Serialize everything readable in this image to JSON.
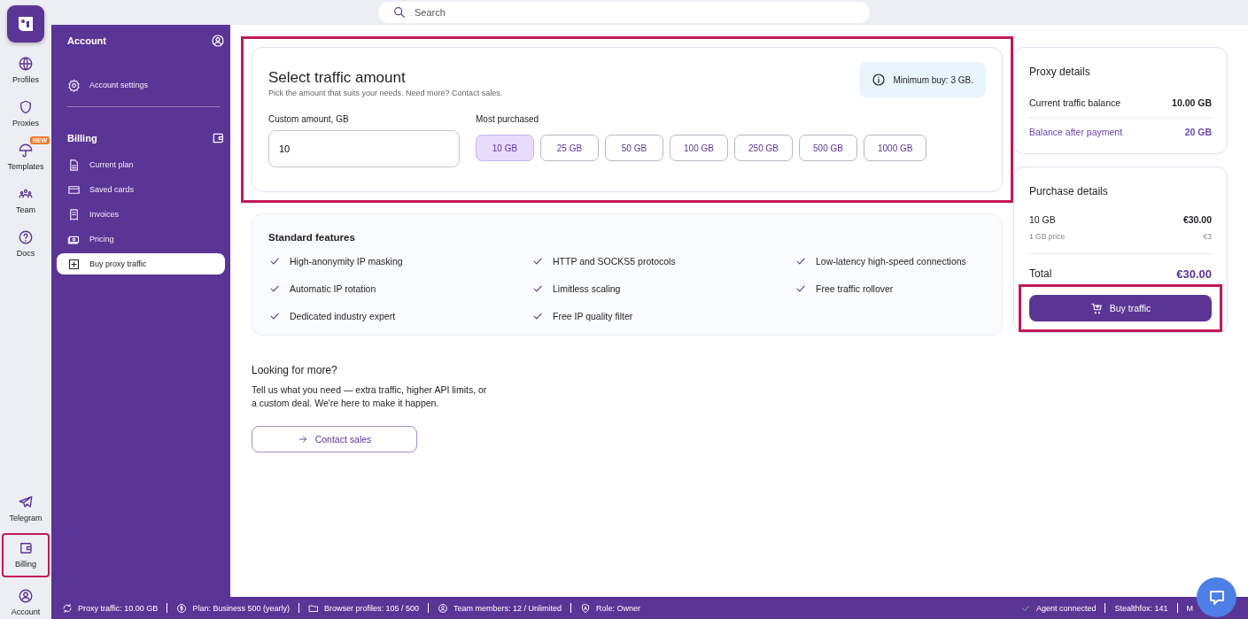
{
  "search": {
    "placeholder": "Search"
  },
  "rail": {
    "top": [
      {
        "label": "Profiles",
        "highlighted": false
      },
      {
        "label": "Proxies",
        "highlighted": false
      },
      {
        "label": "Templates",
        "highlighted": false,
        "badge": "NEW"
      },
      {
        "label": "Team",
        "highlighted": false
      },
      {
        "label": "Docs",
        "highlighted": false
      }
    ],
    "bottom": [
      {
        "label": "Telegram",
        "highlighted": false
      },
      {
        "label": "Billing",
        "highlighted": true
      },
      {
        "label": "Account",
        "highlighted": false
      }
    ]
  },
  "panel": {
    "account_title": "Account",
    "account_items": [
      {
        "label": "Account settings",
        "selected": false
      }
    ],
    "billing_title": "Billing",
    "billing_items": [
      {
        "label": "Current plan",
        "selected": false
      },
      {
        "label": "Saved cards",
        "selected": false
      },
      {
        "label": "Invoices",
        "selected": false
      },
      {
        "label": "Pricing",
        "selected": false
      },
      {
        "label": "Buy proxy traffic",
        "selected": true
      }
    ]
  },
  "traffic": {
    "title": "Select traffic amount",
    "subtitle": "Pick the amount that suits your needs. Need more? Contact sales.",
    "note": "Minimum buy: 3 GB.",
    "highlighted": true,
    "custom": {
      "label": "Custom amount, GB",
      "value": "10"
    },
    "presets_label": "Most purchased",
    "presets": [
      {
        "label": "10 GB",
        "selected": true
      },
      {
        "label": "25 GB",
        "selected": false
      },
      {
        "label": "50 GB",
        "selected": false
      },
      {
        "label": "100 GB",
        "selected": false
      },
      {
        "label": "250 GB",
        "selected": false
      },
      {
        "label": "500 GB",
        "selected": false
      },
      {
        "label": "1000 GB",
        "selected": false
      }
    ]
  },
  "features": {
    "title": "Standard features",
    "items": [
      "High-anonymity IP masking",
      "HTTP and SOCKS5 protocols",
      "Low-latency high-speed connections",
      "Automatic IP rotation",
      "Limitless scaling",
      "Free traffic rollover",
      "Dedicated industry expert",
      "Free IP quality filter"
    ]
  },
  "more": {
    "title": "Looking for more?",
    "text": "Tell us what you need — extra traffic, higher API limits, or a custom deal. We're here to make it happen.",
    "button": "Contact sales"
  },
  "proxy_details": {
    "title": "Proxy details",
    "rows": [
      {
        "label": "Current traffic balance",
        "value": "10.00 GB",
        "kind": "normal"
      },
      {
        "label": "Balance after payment",
        "value": "20 GB",
        "kind": "accent"
      }
    ]
  },
  "purchase": {
    "title": "Purchase details",
    "rows": [
      {
        "label": "10 GB",
        "value": "€30.00",
        "kind": "normal"
      },
      {
        "label": "1 GB price",
        "value": "€3",
        "kind": "muted"
      }
    ],
    "total": {
      "label": "Total",
      "value": "€30.00"
    },
    "button": {
      "label": "Buy traffic",
      "highlighted": true
    }
  },
  "status_bar": {
    "left": [
      "Proxy traffic: 10.00 GB",
      "Plan: Business 500 (yearly)",
      "Browser profiles: 105 / 500",
      "Team members: 12 / Unlimited",
      "Role: Owner"
    ],
    "right": [
      "Agent connected",
      "Stealthfox: 141",
      "M"
    ]
  }
}
